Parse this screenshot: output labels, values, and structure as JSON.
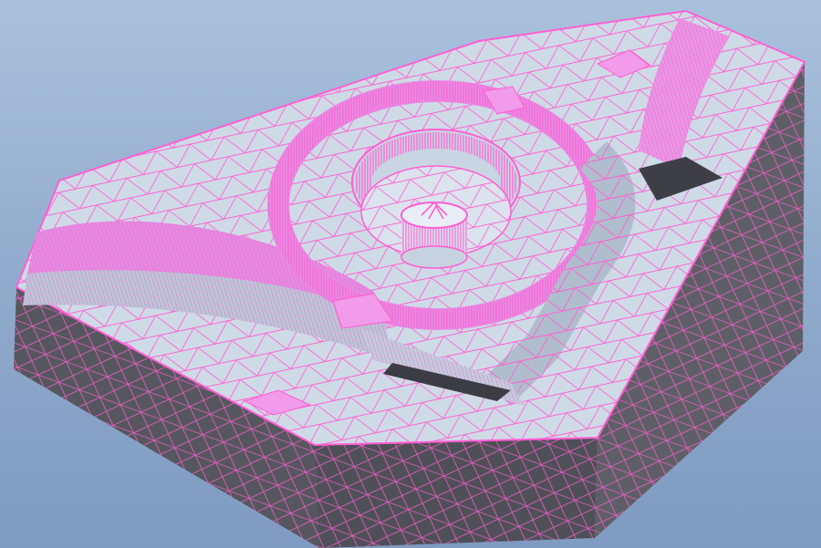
{
  "viewport": {
    "background_top": "#a9c1dc",
    "background_bottom": "#7f9bc2"
  },
  "model": {
    "view": "3d-isometric-shaded-with-mesh",
    "mesh_color": "#ff5fd2",
    "top_face_color": "#cdd9e6",
    "side_face_color": "#5a5b62",
    "features": [
      "scroll-volute-channel",
      "inlet-channel-top-right",
      "outlet-channel-left",
      "center-boss",
      "circular-recess"
    ]
  }
}
